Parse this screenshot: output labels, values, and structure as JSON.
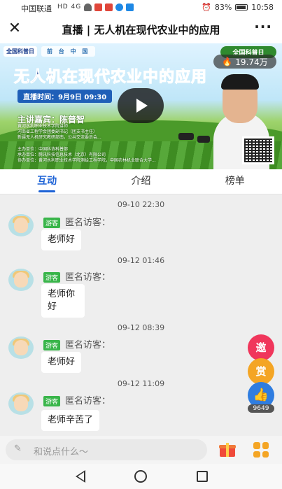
{
  "status_bar": {
    "carrier": "中国联通",
    "network": "HD 4G",
    "battery": "83%",
    "time": "10:58"
  },
  "header": {
    "title": "直播 | 无人机在现代农业中的应用"
  },
  "video": {
    "logo_left": "全国科普日",
    "logo_right": "前 台 中 国",
    "badge": "全国科普日",
    "views": "19.74万",
    "title": "无人机在现代农业中的应用",
    "time_label": "直播时间：9月9日 09:30",
    "speaker": "主讲嘉宾：陈普智",
    "speaker_info": [
      "黄河水利职业技术学院讲师",
      "河南省工程学会团委副书记（团支书主任）",
      "新疆无人机研究教研部南，公共交流委员会..."
    ],
    "orgs": [
      "主办单位：中国科协科普部",
      "承办单位：腾讯科技信息技术（北京）有限公司",
      "协办单位：黄河水利职业技术学院测绘工程学院，中国农林机业联合大学..."
    ]
  },
  "tabs": [
    "互动",
    "介绍",
    "榜单"
  ],
  "messages": [
    {
      "time": "09-10 22:30",
      "tag": "游客",
      "user": "匿名访客：",
      "text": "老师好"
    },
    {
      "time": "09-12 01:46",
      "tag": "游客",
      "user": "匿名访客：",
      "text": "老师你好"
    },
    {
      "time": "09-12 08:39",
      "tag": "游客",
      "user": "匿名访客：",
      "text": "老师好"
    },
    {
      "time": "09-12 11:09",
      "tag": "游客",
      "user": "匿名访客：",
      "text": "老师辛苦了"
    }
  ],
  "floating": {
    "invite": "邀",
    "reward": "赏",
    "like_count": "9649"
  },
  "input": {
    "placeholder": "和说点什么～"
  },
  "colors": {
    "accent": "#1e63d6",
    "guest_tag": "#39b54a",
    "invite": "#f0365b",
    "reward": "#f4a524"
  }
}
